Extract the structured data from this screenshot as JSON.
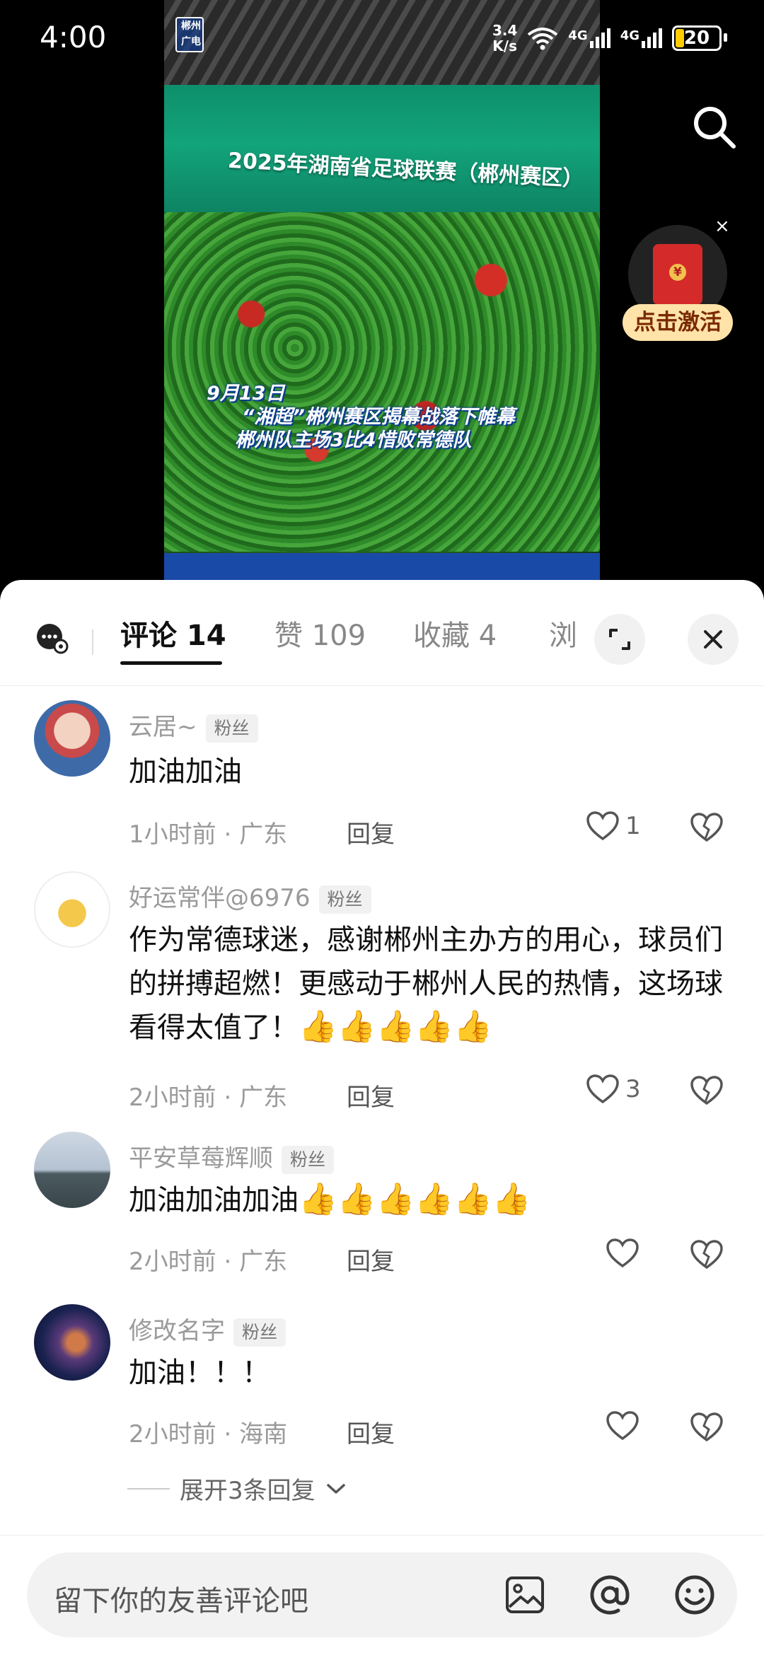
{
  "status_bar": {
    "time": "4:00",
    "net_speed_value": "3.4",
    "net_speed_unit": "K/s",
    "signal_1": "4G",
    "signal_2": "4G",
    "battery": "20"
  },
  "video": {
    "channel_logo": "郴州广电",
    "banner_text": "2025年湖南省足球联赛（郴州赛区）",
    "caption_lines": [
      "9月13日",
      "“湘超”郴州赛区揭幕战落下帷幕",
      "郴州队主场3比4惜败常德队"
    ]
  },
  "red_packet": {
    "label": "点击激活",
    "close": "×"
  },
  "tabs": {
    "comments": "评论 14",
    "likes": "赞 109",
    "favorites": "收藏 4",
    "views": "浏"
  },
  "comments": [
    {
      "name": "云居~",
      "badge": "粉丝",
      "text": "加油加油",
      "time": "1小时前",
      "location": "广东",
      "reply": "回复",
      "likes": "1"
    },
    {
      "name": "好运常伴@6976",
      "badge": "粉丝",
      "text": "作为常德球迷，感谢郴州主办方的用心，球员们的拼搏超燃！更感动于郴州人民的热情，这场球看得太值了！",
      "emojis": "👍👍👍👍👍",
      "time": "2小时前",
      "location": "广东",
      "reply": "回复",
      "likes": "3"
    },
    {
      "name": "平安草莓辉顺",
      "badge": "粉丝",
      "text": "加油加油加油",
      "emojis": "👍👍👍👍👍👍",
      "time": "2小时前",
      "location": "广东",
      "reply": "回复",
      "likes": ""
    },
    {
      "name": "修改名字",
      "badge": "粉丝",
      "text": "加油！！！",
      "time": "2小时前",
      "location": "海南",
      "reply": "回复",
      "likes": ""
    }
  ],
  "expand_replies": "展开3条回复",
  "input": {
    "placeholder": "留下你的友善评论吧"
  },
  "icons": {
    "search": "search-icon",
    "close": "close-icon",
    "expand": "expand-icon",
    "heart": "heart-icon",
    "dislike": "broken-heart-icon",
    "image": "image-icon",
    "mention": "at-icon",
    "emoji": "emoji-icon"
  }
}
